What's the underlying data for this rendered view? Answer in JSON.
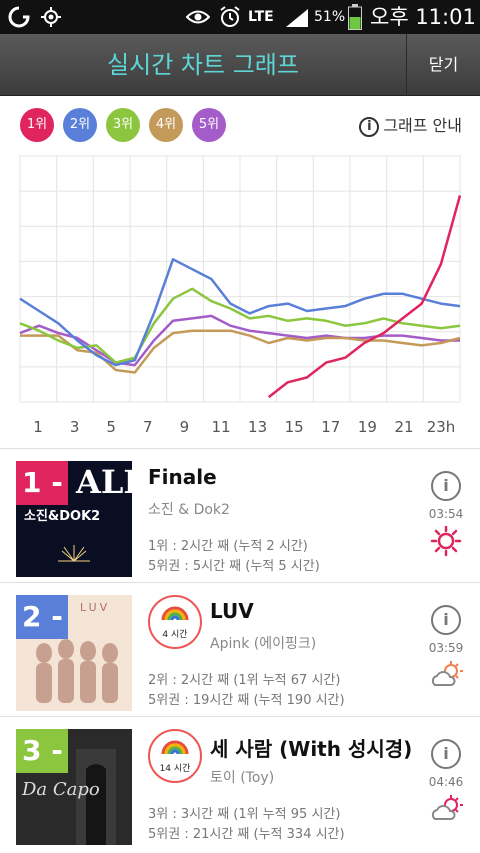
{
  "status_bar": {
    "network": "LTE",
    "battery": "51%",
    "time": "오후 11:01",
    "icons": [
      "carrier-icon",
      "gps-icon",
      "eye-icon",
      "alarm-icon",
      "signal-icon",
      "battery-icon"
    ]
  },
  "header": {
    "title": "실시간 차트 그래프",
    "close_label": "닫기"
  },
  "legend": {
    "ranks": [
      {
        "label": "1위",
        "color": "#e0245e"
      },
      {
        "label": "2위",
        "color": "#5a7fd8"
      },
      {
        "label": "3위",
        "color": "#8cc63e"
      },
      {
        "label": "4위",
        "color": "#c49a5a"
      },
      {
        "label": "5위",
        "color": "#a45cc8"
      }
    ],
    "guide_label": "그래프 안내"
  },
  "chart_data": {
    "type": "line",
    "x": [
      "0h",
      "1h",
      "2h",
      "3h",
      "4h",
      "5h",
      "6h",
      "7h",
      "8h",
      "9h",
      "10h",
      "11h",
      "12h",
      "13h",
      "14h",
      "15h",
      "16h",
      "17h",
      "18h",
      "19h",
      "20h",
      "21h",
      "22h",
      "23h"
    ],
    "x_tick_labels": [
      "1",
      "3",
      "5",
      "7",
      "9",
      "11",
      "13",
      "15",
      "17",
      "19",
      "21",
      "23h"
    ],
    "ylim": [
      0,
      100
    ],
    "grid": true,
    "series": [
      {
        "name": "1위",
        "color": "#e0245e",
        "values": [
          null,
          null,
          null,
          null,
          null,
          null,
          null,
          null,
          null,
          null,
          null,
          null,
          null,
          2,
          8,
          10,
          16,
          18,
          24,
          28,
          34,
          40,
          56,
          84
        ]
      },
      {
        "name": "2위",
        "color": "#5a7fd8",
        "values": [
          42,
          37,
          32,
          25,
          19,
          15,
          17,
          36,
          58,
          54,
          50,
          40,
          36,
          39,
          40,
          37,
          38,
          39,
          42,
          44,
          44,
          42,
          40,
          39
        ]
      },
      {
        "name": "3위",
        "color": "#8cc63e",
        "values": [
          32,
          29,
          25,
          22,
          23,
          16,
          18,
          32,
          42,
          46,
          41,
          38,
          34,
          35,
          33,
          34,
          33,
          31,
          32,
          34,
          32,
          31,
          30,
          31
        ]
      },
      {
        "name": "4위",
        "color": "#c49a5a",
        "values": [
          27,
          27,
          27,
          21,
          20,
          13,
          12,
          22,
          28,
          29,
          29,
          29,
          27,
          24,
          26,
          25,
          26,
          26,
          25,
          25,
          24,
          23,
          24,
          26
        ]
      },
      {
        "name": "5위",
        "color": "#a45cc8",
        "values": [
          28,
          31,
          28,
          26,
          21,
          16,
          15,
          25,
          33,
          34,
          35,
          31,
          29,
          28,
          27,
          26,
          27,
          26,
          26,
          27,
          27,
          26,
          25,
          25
        ]
      }
    ]
  },
  "songs": [
    {
      "rank": "1 -",
      "rank_color": "#e0245e",
      "title": "Finale",
      "artist": "소진 & Dok2",
      "line1": "1위 : 2시간 째 (누적 2 시간)",
      "line2": "5위권 : 5시간 째 (누적 5 시간)",
      "badge": "",
      "duration": "03:54",
      "weather": "sun-icon",
      "art_text": "소진&DOK2",
      "art_big": "ALE"
    },
    {
      "rank": "2 -",
      "rank_color": "#5a7fd8",
      "title": "LUV",
      "artist": "Apink (에이핑크)",
      "line1": "2위 : 2시간 째 (1위 누적 67 시간)",
      "line2": "5위권 : 19시간 째 (누적 190 시간)",
      "badge": "4 시간",
      "duration": "03:59",
      "weather": "cloud-sun-icon",
      "art_text": "LUV"
    },
    {
      "rank": "3 -",
      "rank_color": "#8cc63e",
      "title": "세 사람 (With 성시경)",
      "artist": "토이 (Toy)",
      "line1": "3위 : 3시간 째 (1위 누적 95 시간)",
      "line2": "5위권 : 21시간 째 (누적 334 시간)",
      "badge": "14 시간",
      "duration": "04:46",
      "weather": "cloud-sun-icon",
      "art_text": "Da Capo"
    }
  ]
}
